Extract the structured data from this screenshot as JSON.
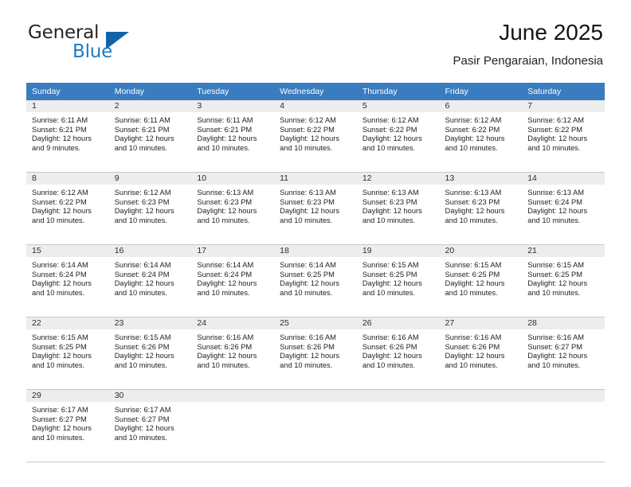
{
  "brand": {
    "name_top": "General",
    "name_bottom": "Blue",
    "triangle_color": "#1263a8",
    "accent_color": "#1f7ac4"
  },
  "header": {
    "title": "June 2025",
    "subtitle": "Pasir Pengaraian, Indonesia"
  },
  "calendar": {
    "header_bg": "#3a7cc0",
    "daynum_bg": "#ededed",
    "weekdays": [
      "Sunday",
      "Monday",
      "Tuesday",
      "Wednesday",
      "Thursday",
      "Friday",
      "Saturday"
    ],
    "weeks": [
      [
        {
          "day": "",
          "sunrise": "",
          "sunset": "",
          "daylight": "",
          "daylight2": ""
        },
        {
          "day": "",
          "sunrise": "",
          "sunset": "",
          "daylight": "",
          "daylight2": ""
        },
        {
          "day": "",
          "sunrise": "",
          "sunset": "",
          "daylight": "",
          "daylight2": ""
        },
        {
          "day": "",
          "sunrise": "",
          "sunset": "",
          "daylight": "",
          "daylight2": ""
        },
        {
          "day": "",
          "sunrise": "",
          "sunset": "",
          "daylight": "",
          "daylight2": ""
        },
        {
          "day": "",
          "sunrise": "",
          "sunset": "",
          "daylight": "",
          "daylight2": ""
        },
        {
          "day": "",
          "sunrise": "",
          "sunset": "",
          "daylight": "",
          "daylight2": ""
        }
      ],
      [
        {
          "day": "1",
          "sunrise": "Sunrise: 6:11 AM",
          "sunset": "Sunset: 6:21 PM",
          "daylight": "Daylight: 12 hours",
          "daylight2": "and 9 minutes."
        },
        {
          "day": "2",
          "sunrise": "Sunrise: 6:11 AM",
          "sunset": "Sunset: 6:21 PM",
          "daylight": "Daylight: 12 hours",
          "daylight2": "and 10 minutes."
        },
        {
          "day": "3",
          "sunrise": "Sunrise: 6:11 AM",
          "sunset": "Sunset: 6:21 PM",
          "daylight": "Daylight: 12 hours",
          "daylight2": "and 10 minutes."
        },
        {
          "day": "4",
          "sunrise": "Sunrise: 6:12 AM",
          "sunset": "Sunset: 6:22 PM",
          "daylight": "Daylight: 12 hours",
          "daylight2": "and 10 minutes."
        },
        {
          "day": "5",
          "sunrise": "Sunrise: 6:12 AM",
          "sunset": "Sunset: 6:22 PM",
          "daylight": "Daylight: 12 hours",
          "daylight2": "and 10 minutes."
        },
        {
          "day": "6",
          "sunrise": "Sunrise: 6:12 AM",
          "sunset": "Sunset: 6:22 PM",
          "daylight": "Daylight: 12 hours",
          "daylight2": "and 10 minutes."
        },
        {
          "day": "7",
          "sunrise": "Sunrise: 6:12 AM",
          "sunset": "Sunset: 6:22 PM",
          "daylight": "Daylight: 12 hours",
          "daylight2": "and 10 minutes."
        }
      ],
      [
        {
          "day": "8",
          "sunrise": "Sunrise: 6:12 AM",
          "sunset": "Sunset: 6:22 PM",
          "daylight": "Daylight: 12 hours",
          "daylight2": "and 10 minutes."
        },
        {
          "day": "9",
          "sunrise": "Sunrise: 6:12 AM",
          "sunset": "Sunset: 6:23 PM",
          "daylight": "Daylight: 12 hours",
          "daylight2": "and 10 minutes."
        },
        {
          "day": "10",
          "sunrise": "Sunrise: 6:13 AM",
          "sunset": "Sunset: 6:23 PM",
          "daylight": "Daylight: 12 hours",
          "daylight2": "and 10 minutes."
        },
        {
          "day": "11",
          "sunrise": "Sunrise: 6:13 AM",
          "sunset": "Sunset: 6:23 PM",
          "daylight": "Daylight: 12 hours",
          "daylight2": "and 10 minutes."
        },
        {
          "day": "12",
          "sunrise": "Sunrise: 6:13 AM",
          "sunset": "Sunset: 6:23 PM",
          "daylight": "Daylight: 12 hours",
          "daylight2": "and 10 minutes."
        },
        {
          "day": "13",
          "sunrise": "Sunrise: 6:13 AM",
          "sunset": "Sunset: 6:23 PM",
          "daylight": "Daylight: 12 hours",
          "daylight2": "and 10 minutes."
        },
        {
          "day": "14",
          "sunrise": "Sunrise: 6:13 AM",
          "sunset": "Sunset: 6:24 PM",
          "daylight": "Daylight: 12 hours",
          "daylight2": "and 10 minutes."
        }
      ],
      [
        {
          "day": "15",
          "sunrise": "Sunrise: 6:14 AM",
          "sunset": "Sunset: 6:24 PM",
          "daylight": "Daylight: 12 hours",
          "daylight2": "and 10 minutes."
        },
        {
          "day": "16",
          "sunrise": "Sunrise: 6:14 AM",
          "sunset": "Sunset: 6:24 PM",
          "daylight": "Daylight: 12 hours",
          "daylight2": "and 10 minutes."
        },
        {
          "day": "17",
          "sunrise": "Sunrise: 6:14 AM",
          "sunset": "Sunset: 6:24 PM",
          "daylight": "Daylight: 12 hours",
          "daylight2": "and 10 minutes."
        },
        {
          "day": "18",
          "sunrise": "Sunrise: 6:14 AM",
          "sunset": "Sunset: 6:25 PM",
          "daylight": "Daylight: 12 hours",
          "daylight2": "and 10 minutes."
        },
        {
          "day": "19",
          "sunrise": "Sunrise: 6:15 AM",
          "sunset": "Sunset: 6:25 PM",
          "daylight": "Daylight: 12 hours",
          "daylight2": "and 10 minutes."
        },
        {
          "day": "20",
          "sunrise": "Sunrise: 6:15 AM",
          "sunset": "Sunset: 6:25 PM",
          "daylight": "Daylight: 12 hours",
          "daylight2": "and 10 minutes."
        },
        {
          "day": "21",
          "sunrise": "Sunrise: 6:15 AM",
          "sunset": "Sunset: 6:25 PM",
          "daylight": "Daylight: 12 hours",
          "daylight2": "and 10 minutes."
        }
      ],
      [
        {
          "day": "22",
          "sunrise": "Sunrise: 6:15 AM",
          "sunset": "Sunset: 6:25 PM",
          "daylight": "Daylight: 12 hours",
          "daylight2": "and 10 minutes."
        },
        {
          "day": "23",
          "sunrise": "Sunrise: 6:15 AM",
          "sunset": "Sunset: 6:26 PM",
          "daylight": "Daylight: 12 hours",
          "daylight2": "and 10 minutes."
        },
        {
          "day": "24",
          "sunrise": "Sunrise: 6:16 AM",
          "sunset": "Sunset: 6:26 PM",
          "daylight": "Daylight: 12 hours",
          "daylight2": "and 10 minutes."
        },
        {
          "day": "25",
          "sunrise": "Sunrise: 6:16 AM",
          "sunset": "Sunset: 6:26 PM",
          "daylight": "Daylight: 12 hours",
          "daylight2": "and 10 minutes."
        },
        {
          "day": "26",
          "sunrise": "Sunrise: 6:16 AM",
          "sunset": "Sunset: 6:26 PM",
          "daylight": "Daylight: 12 hours",
          "daylight2": "and 10 minutes."
        },
        {
          "day": "27",
          "sunrise": "Sunrise: 6:16 AM",
          "sunset": "Sunset: 6:26 PM",
          "daylight": "Daylight: 12 hours",
          "daylight2": "and 10 minutes."
        },
        {
          "day": "28",
          "sunrise": "Sunrise: 6:16 AM",
          "sunset": "Sunset: 6:27 PM",
          "daylight": "Daylight: 12 hours",
          "daylight2": "and 10 minutes."
        }
      ],
      [
        {
          "day": "29",
          "sunrise": "Sunrise: 6:17 AM",
          "sunset": "Sunset: 6:27 PM",
          "daylight": "Daylight: 12 hours",
          "daylight2": "and 10 minutes."
        },
        {
          "day": "30",
          "sunrise": "Sunrise: 6:17 AM",
          "sunset": "Sunset: 6:27 PM",
          "daylight": "Daylight: 12 hours",
          "daylight2": "and 10 minutes."
        },
        {
          "day": "",
          "sunrise": "",
          "sunset": "",
          "daylight": "",
          "daylight2": ""
        },
        {
          "day": "",
          "sunrise": "",
          "sunset": "",
          "daylight": "",
          "daylight2": ""
        },
        {
          "day": "",
          "sunrise": "",
          "sunset": "",
          "daylight": "",
          "daylight2": ""
        },
        {
          "day": "",
          "sunrise": "",
          "sunset": "",
          "daylight": "",
          "daylight2": ""
        },
        {
          "day": "",
          "sunrise": "",
          "sunset": "",
          "daylight": "",
          "daylight2": ""
        }
      ]
    ]
  }
}
